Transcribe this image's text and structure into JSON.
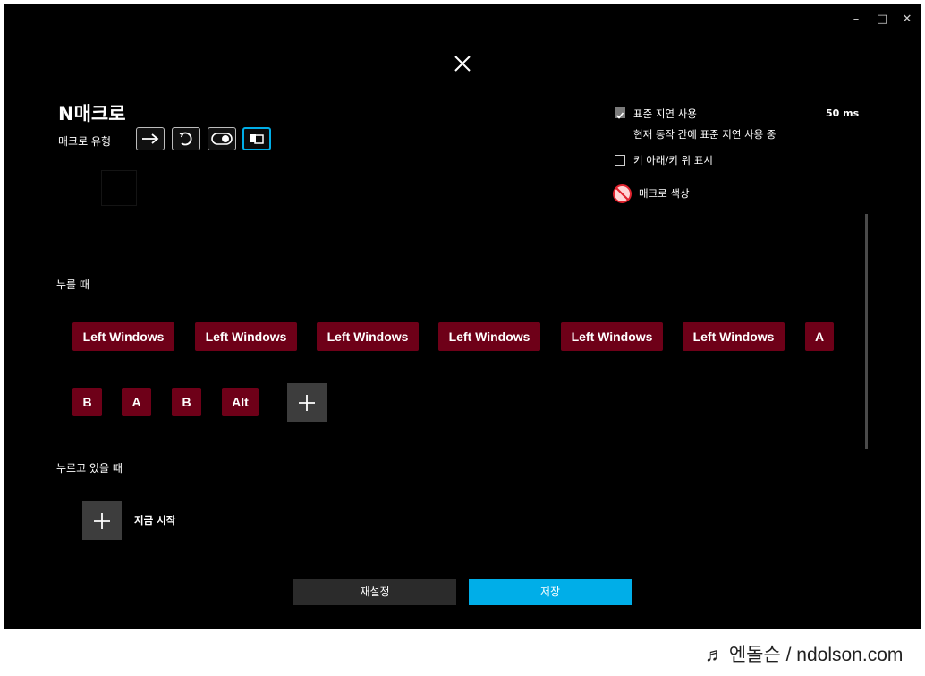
{
  "window_controls": {
    "minimize": "–",
    "maximize": "□",
    "close": "✕"
  },
  "dialog": {
    "title": "N매크로",
    "macro_type_label": "매크로 유형",
    "macro_types": [
      "arrow-right-icon",
      "repeat-icon",
      "toggle-icon",
      "sequence-icon"
    ],
    "active_macro_type": 3
  },
  "options": {
    "standard_delay_label": "표준 지연 사용",
    "standard_delay_checked": true,
    "standard_delay_value": "50 ms",
    "standard_delay_desc": "현재 동작 간에 표준 지연 사용 중",
    "show_updown_label": "키 아래/키 위 표시",
    "show_updown_checked": false,
    "macro_color_label": "매크로 색상"
  },
  "on_press": {
    "label": "누를 때",
    "keys_row1": [
      "Left Windows",
      "Left Windows",
      "Left Windows",
      "Left Windows",
      "Left Windows",
      "Left Windows",
      "A"
    ],
    "keys_row2": [
      "B",
      "A",
      "B",
      "Alt"
    ]
  },
  "while_holding": {
    "label": "누르고 있을 때",
    "start_now_label": "지금 시작"
  },
  "buttons": {
    "reset": "재설정",
    "save": "저장"
  },
  "colors": {
    "key_bg": "#6e0018",
    "save_bg": "#00aee8",
    "reset_bg": "#2b2b2b",
    "accent": "#00aee8"
  },
  "watermark": "♬ 엔돌슨 / ndolson.com"
}
